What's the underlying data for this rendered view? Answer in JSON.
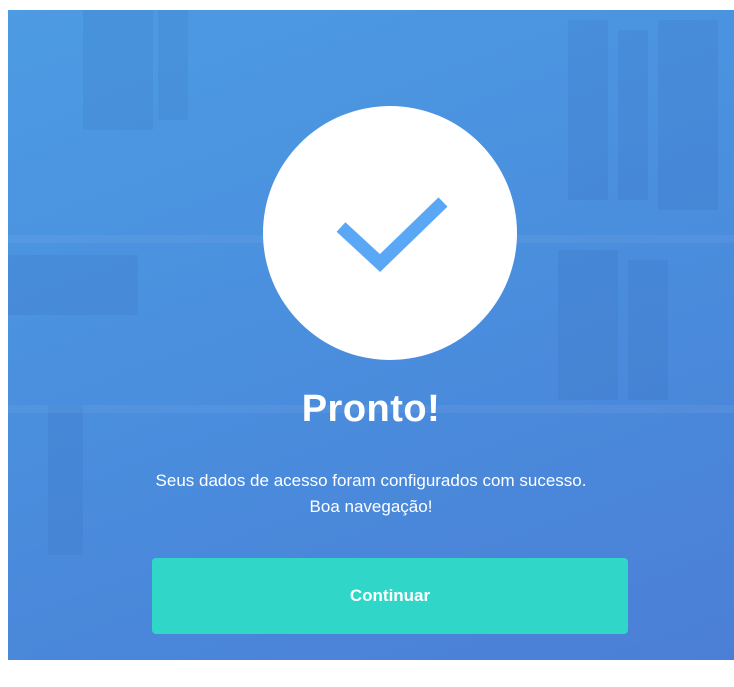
{
  "modal": {
    "title": "Pronto!",
    "message_line_1": "Seus dados de acesso foram configurados com sucesso.",
    "message_line_2": "Boa navegação!",
    "continue_label": "Continuar",
    "icon": "checkmark-icon"
  },
  "colors": {
    "background_start": "#4d9be3",
    "background_end": "#4b7fd6",
    "circle": "#ffffff",
    "checkmark": "#5aa8f5",
    "button": "#30d7c8",
    "text": "#ffffff"
  }
}
